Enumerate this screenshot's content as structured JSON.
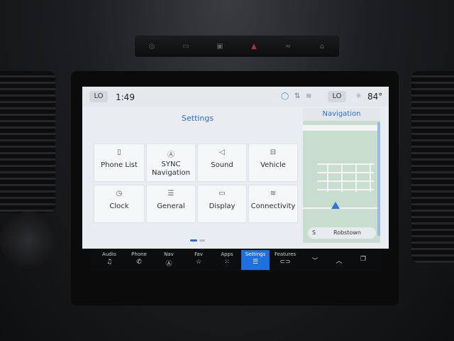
{
  "status": {
    "left_zone": "LO",
    "time": "1:49",
    "right_zone": "LO",
    "outside_temp": "84°"
  },
  "settings": {
    "title": "Settings",
    "tiles": [
      {
        "label": "Phone List",
        "icon": "phone-list-icon"
      },
      {
        "label": "SYNC\nNavigation",
        "icon": "sync-navigation-icon"
      },
      {
        "label": "Sound",
        "icon": "speaker-icon"
      },
      {
        "label": "Vehicle",
        "icon": "vehicle-icon"
      },
      {
        "label": "Clock",
        "icon": "clock-icon"
      },
      {
        "label": "General",
        "icon": "sliders-icon"
      },
      {
        "label": "Display",
        "icon": "display-icon"
      },
      {
        "label": "Connectivity",
        "icon": "wifi-icon"
      }
    ]
  },
  "navigation": {
    "title": "Navigation",
    "compass": "S",
    "street": "Robstown"
  },
  "dock": {
    "items": [
      {
        "label": "Audio",
        "icon": "music-note-icon"
      },
      {
        "label": "Phone",
        "icon": "phone-icon"
      },
      {
        "label": "Nav",
        "icon": "nav-compass-icon"
      },
      {
        "label": "Fav",
        "icon": "star-icon"
      },
      {
        "label": "Apps",
        "icon": "apps-grid-icon"
      },
      {
        "label": "Settings",
        "icon": "settings-sliders-icon",
        "active": true
      },
      {
        "label": "Features",
        "icon": "car-icon"
      }
    ]
  },
  "colors": {
    "accent": "#2a6fd6",
    "dock_active": "#1f6fe0",
    "hazard": "#b3323a"
  }
}
